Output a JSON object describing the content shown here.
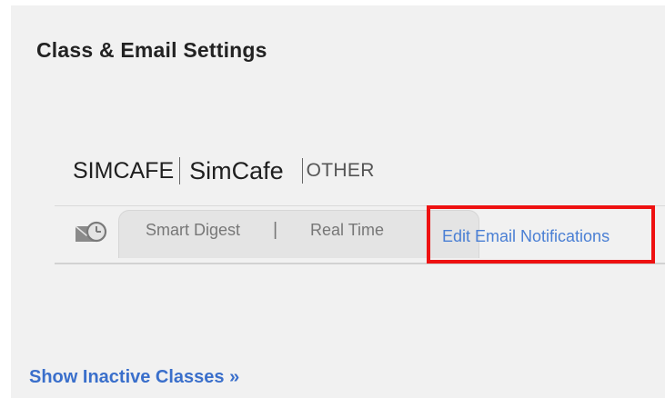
{
  "page_title": "Class & Email Settings",
  "class": {
    "code": "SIMCAFE",
    "name": "SimCafe",
    "type": "OTHER"
  },
  "notifications": {
    "icon": "mail-clock-icon",
    "modes": {
      "smart_digest": "Smart Digest",
      "divider": "|",
      "real_time": "Real Time"
    },
    "edit_link": "Edit Email Notifications"
  },
  "footer": {
    "show_inactive": "Show Inactive Classes »"
  },
  "colors": {
    "highlight": "#ee1111",
    "link": "#4a7fd4"
  }
}
